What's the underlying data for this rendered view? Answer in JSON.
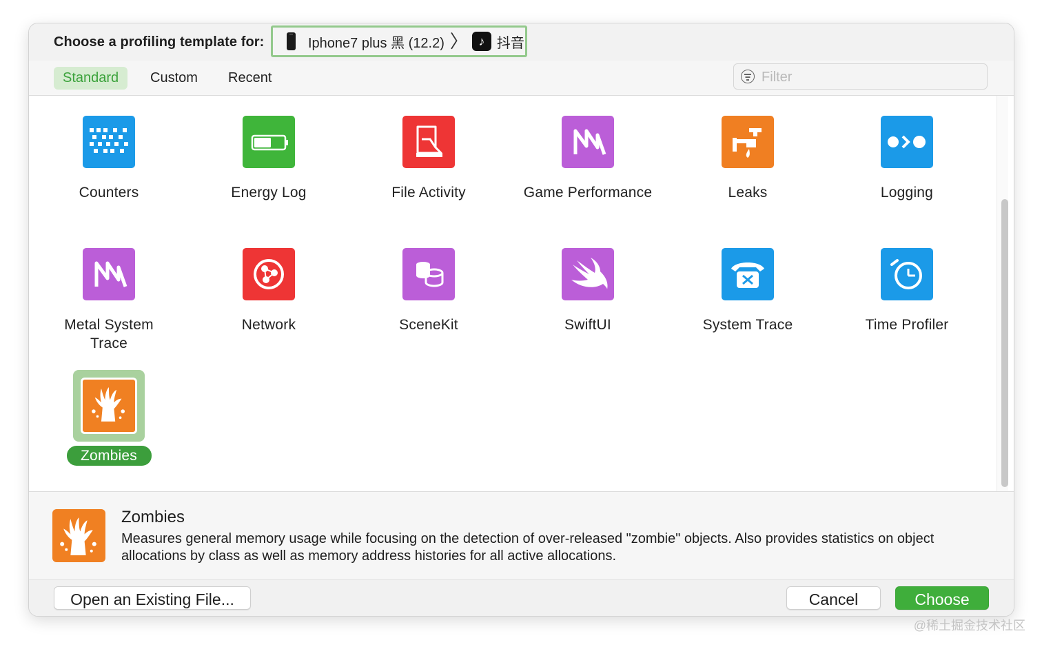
{
  "header": {
    "label": "Choose a profiling template for:",
    "device": "Iphone7 plus 黑 (12.2)",
    "chevron": "〉",
    "app_icon_glyph": "♪",
    "app": "抖音"
  },
  "tabs": [
    {
      "label": "Standard",
      "active": true
    },
    {
      "label": "Custom",
      "active": false
    },
    {
      "label": "Recent",
      "active": false
    }
  ],
  "filter": {
    "placeholder": "Filter",
    "value": ""
  },
  "templates": [
    {
      "label": "Counters",
      "icon": "counters-icon",
      "color": "#1b9ae8"
    },
    {
      "label": "Energy Log",
      "icon": "battery-icon",
      "color": "#3fb53a"
    },
    {
      "label": "File Activity",
      "icon": "file-activity-icon",
      "color": "#ee3535"
    },
    {
      "label": "Game Performance",
      "icon": "game-performance-icon",
      "color": "#bb5ed8"
    },
    {
      "label": "Leaks",
      "icon": "leaks-faucet-icon",
      "color": "#f07f22"
    },
    {
      "label": "Logging",
      "icon": "logging-icon",
      "color": "#1b9ae8"
    },
    {
      "label": "Metal System Trace",
      "icon": "metal-icon",
      "color": "#bb5ed8"
    },
    {
      "label": "Network",
      "icon": "network-icon",
      "color": "#ee3535"
    },
    {
      "label": "SceneKit",
      "icon": "scenekit-icon",
      "color": "#bb5ed8"
    },
    {
      "label": "SwiftUI",
      "icon": "swift-icon",
      "color": "#bb5ed8"
    },
    {
      "label": "System Trace",
      "icon": "telephone-icon",
      "color": "#1b9ae8"
    },
    {
      "label": "Time Profiler",
      "icon": "timer-icon",
      "color": "#1b9ae8"
    },
    {
      "label": "Zombies",
      "icon": "zombie-hand-icon",
      "color": "#f07f22",
      "selected": true
    }
  ],
  "description": {
    "title": "Zombies",
    "text": "Measures general memory usage while focusing on the detection of over-released \"zombie\" objects.  Also provides statistics on object allocations by class as well as memory address histories for all active allocations."
  },
  "footer": {
    "open_label": "Open an Existing File...",
    "cancel_label": "Cancel",
    "choose_label": "Choose"
  },
  "watermark": "@稀土掘金技术社区"
}
